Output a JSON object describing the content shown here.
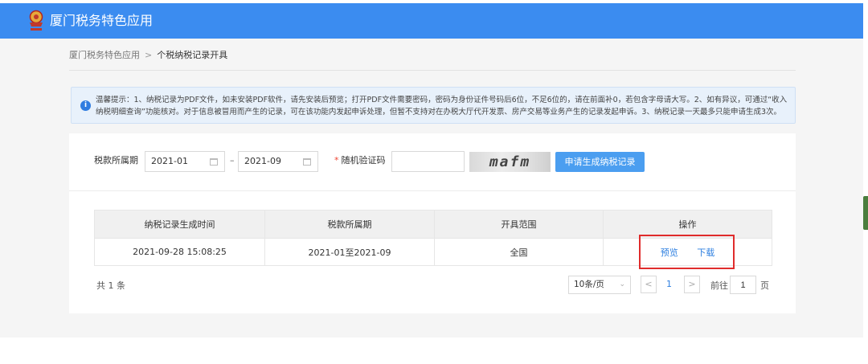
{
  "header": {
    "title": "厦门税务特色应用"
  },
  "breadcrumb": {
    "root": "厦门税务特色应用",
    "separator": ">",
    "current": "个税纳税记录开具"
  },
  "notice": {
    "text": "温馨提示：1、纳税记录为PDF文件，如未安装PDF软件，请先安装后预览；打开PDF文件需要密码，密码为身份证件号码后6位，不足6位的，请在前面补0，若包含字母请大写。2、如有异议，可通过“收入纳税明细查询”功能核对。对于信息被冒用而产生的记录，可在该功能内发起申诉处理，但暂不支持对在办税大厅代开发票、房产交易等业务产生的记录发起申诉。3、纳税记录一天最多只能申请生成3次。"
  },
  "form": {
    "period_label": "税款所属期",
    "start_period": "2021-01",
    "end_period": "2021-09",
    "range_dash": "–",
    "captcha_label": "随机验证码",
    "captcha_required_mark": "*",
    "captcha_value": "",
    "captcha_text": "mafm",
    "apply_button": "申请生成纳税记录"
  },
  "table": {
    "columns": [
      "纳税记录生成时间",
      "税款所属期",
      "开具范围",
      "操作"
    ],
    "rows": [
      {
        "generated_time": "2021-09-28 15:08:25",
        "period": "2021-01至2021-09",
        "scope": "全国",
        "actions": [
          "预览",
          "下载"
        ]
      }
    ]
  },
  "pagination": {
    "total": "共 1 条",
    "page_size": "10条/页",
    "page_size_arrow": "⌄",
    "prev": "<",
    "current_page": "1",
    "next": ">",
    "goto_label": "前往",
    "goto_value": "1",
    "goto_suffix": "页"
  },
  "colors": {
    "header_bg": "#3b8cf0",
    "button_bg": "#4b9ef0",
    "link": "#2f80e0",
    "highlight": "#e02c2c"
  }
}
